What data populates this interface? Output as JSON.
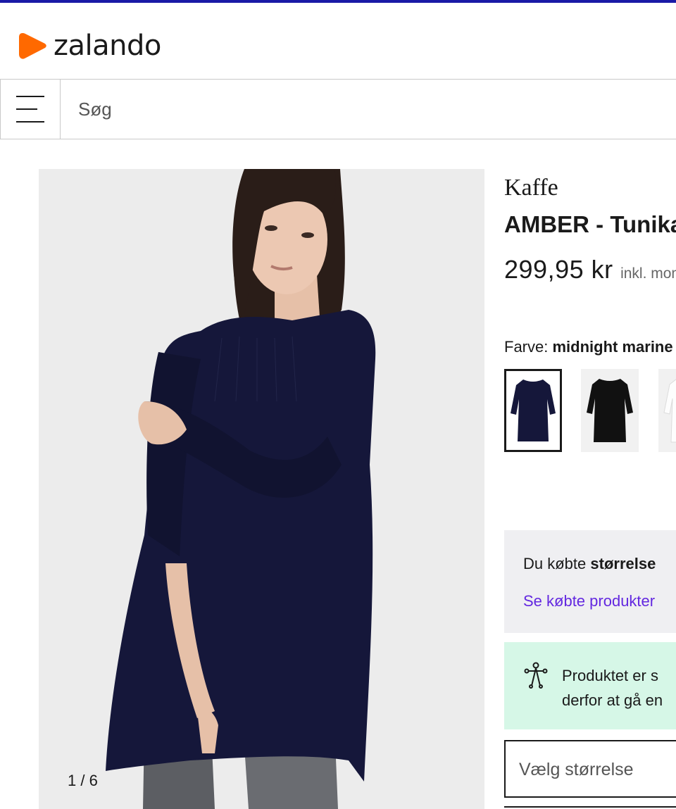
{
  "header": {
    "logo_text": "zalando",
    "brand_color": "#ff6900",
    "top_bar_color": "#1a1aa6"
  },
  "search": {
    "placeholder": "Søg",
    "menu_icon": "hamburger-menu-icon"
  },
  "gallery": {
    "counter": "1 / 6",
    "background": "#ececec"
  },
  "product": {
    "brand": "Kaffe",
    "title": "AMBER - Tunika",
    "price": "299,95 kr",
    "vat_note": "inkl. moms",
    "color_label": "Farve:",
    "color_value": "midnight marine",
    "swatches": [
      {
        "name": "midnight marine",
        "color": "#15173a",
        "selected": true
      },
      {
        "name": "black",
        "color": "#111111",
        "selected": false
      },
      {
        "name": "white",
        "color": "#f4f4f4",
        "selected": false
      }
    ]
  },
  "purchased": {
    "text_prefix": "Du købte",
    "text_bold": "størrelse",
    "link": "Se købte produkter"
  },
  "notice": {
    "icon": "person-size-icon",
    "line1": "Produktet er s",
    "line2": "derfor at gå en"
  },
  "size_select": {
    "placeholder": "Vælg størrelse"
  }
}
